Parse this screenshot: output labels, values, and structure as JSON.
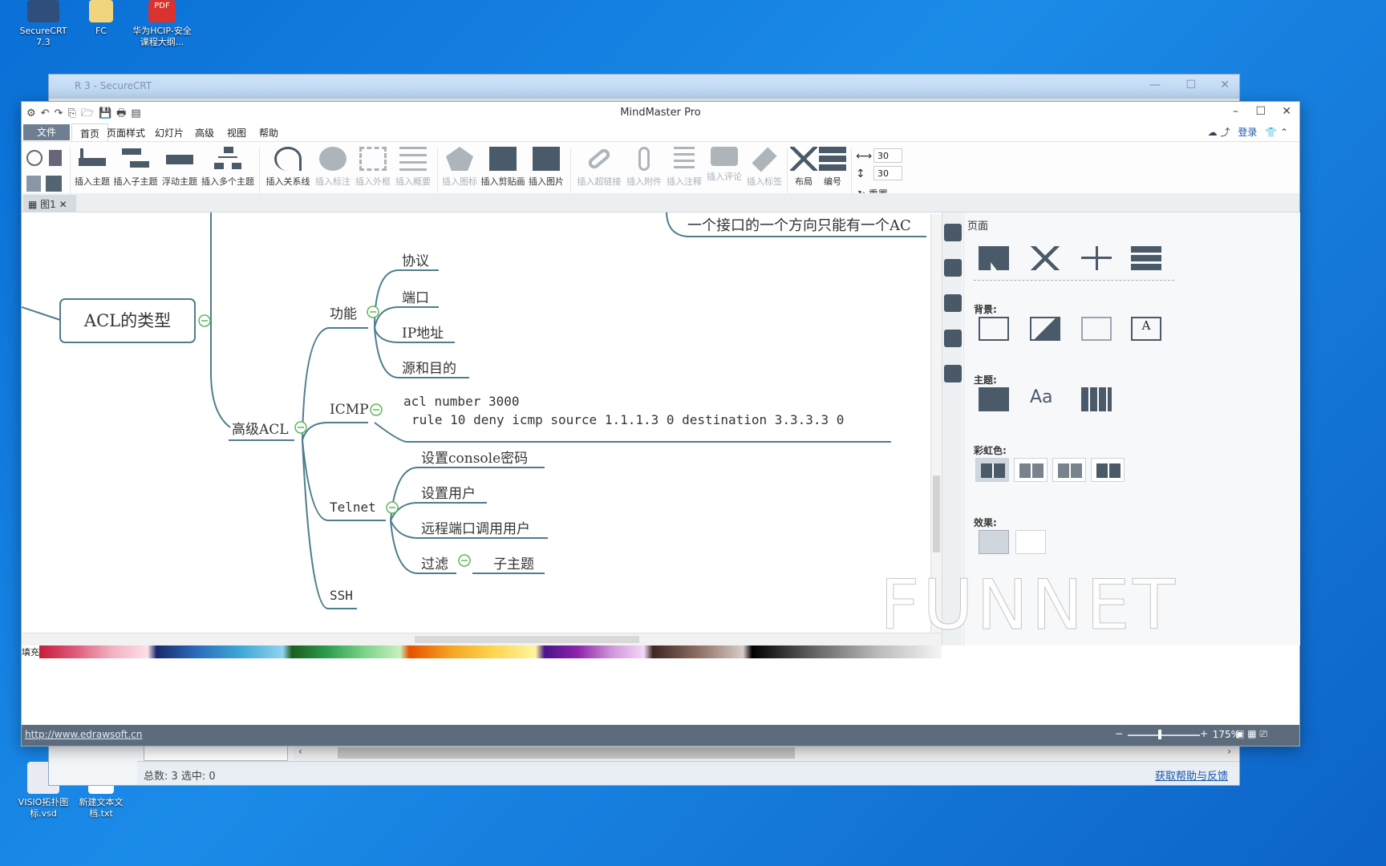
{
  "desktop": {
    "icons": [
      {
        "label": "SecureCRT 7.3",
        "color": "#2f4f7a"
      },
      {
        "label": "FC",
        "color": "#f1d57c"
      },
      {
        "label": "华为HCIP-安全课程大纲...",
        "color": "#d9322f",
        "badge": "PDF"
      },
      {
        "label": "VISIO拓扑图标.vsd",
        "color": "#e9edf3"
      },
      {
        "label": "新建文本文档.txt",
        "color": "#ffffff"
      }
    ]
  },
  "bg_window": {
    "title": "R 3 - SecureCRT",
    "status_left": "总数: 3  选中: 0",
    "status_right": "获取帮助与反馈"
  },
  "app": {
    "title": "MindMaster Pro",
    "menu": [
      "文件",
      "首页",
      "页面样式",
      "幻灯片",
      "高级",
      "视图",
      "帮助"
    ],
    "login": "登录",
    "ribbon": [
      {
        "label": "插入主题",
        "dim": false
      },
      {
        "label": "插入子主题",
        "dim": false
      },
      {
        "label": "浮动主题",
        "dim": false
      },
      {
        "label": "插入多个主题",
        "dim": false
      },
      {
        "label": "插入关系线",
        "dim": false
      },
      {
        "label": "插入标注",
        "dim": true
      },
      {
        "label": "插入外框",
        "dim": true
      },
      {
        "label": "插入概要",
        "dim": true
      },
      {
        "label": "插入图标",
        "dim": true
      },
      {
        "label": "插入剪贴画",
        "dim": false
      },
      {
        "label": "插入图片",
        "dim": false
      },
      {
        "label": "插入超链接",
        "dim": true
      },
      {
        "label": "插入附件",
        "dim": true
      },
      {
        "label": "插入注释",
        "dim": true
      },
      {
        "label": "插入评论",
        "dim": true
      },
      {
        "label": "插入标签",
        "dim": true
      },
      {
        "label": "布局",
        "dim": false
      },
      {
        "label": "编号",
        "dim": false
      }
    ],
    "spacing_h": "30",
    "spacing_v": "30",
    "reset_label": "重置",
    "doc_tab": "图1",
    "status_url": "http://www.edrawsoft.cn",
    "zoom": "175%",
    "fill_label": "填充"
  },
  "mindmap": {
    "top_note": "一个接口的一个方向只能有一个AC",
    "root": "ACL的类型",
    "advanced": "高级ACL",
    "function": "功能",
    "function_children": [
      "协议",
      "端口",
      "IP地址",
      "源和目的"
    ],
    "icmp": "ICMP",
    "icmp_line1": "acl number 3000",
    "icmp_line2": "rule 10 deny icmp source 1.1.1.3 0 destination 3.3.3.3 0",
    "telnet": "Telnet",
    "telnet_children": [
      "设置console密码",
      "设置用户",
      "远程端口调用用户",
      "过滤"
    ],
    "subtopic": "子主题",
    "ssh": "SSH"
  },
  "panel": {
    "title": "页面",
    "background": "背景:",
    "theme": "主题:",
    "rainbow": "彩虹色:",
    "effect": "效果:"
  },
  "watermark": "FUNNET",
  "colors": {
    "accent": "#4e7d8e",
    "node_border": "#4e7d8e",
    "status_bar": "#5c6c7d",
    "collapse": "#5cb85c"
  }
}
